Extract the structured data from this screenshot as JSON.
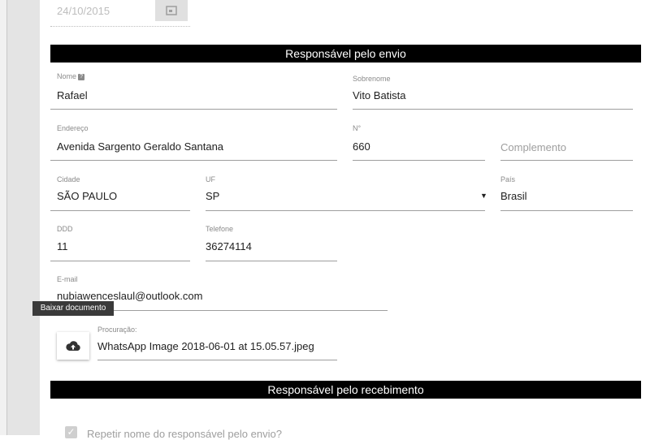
{
  "date_field": {
    "value": "24/10/2015"
  },
  "section_sender": {
    "title": "Responsável pelo envio"
  },
  "section_receiver": {
    "title": "Responsável pelo recebimento"
  },
  "fields": {
    "nome": {
      "label": "Nome",
      "value": "Rafael"
    },
    "sobrenome": {
      "label": "Sobrenome",
      "value": "Vito Batista"
    },
    "endereco": {
      "label": "Endereço",
      "value": "Avenida Sargento Geraldo Santana"
    },
    "numero": {
      "label": "N°",
      "value": "660"
    },
    "complemento": {
      "placeholder": "Complemento"
    },
    "cidade": {
      "label": "Cidade",
      "value": "SÃO PAULO"
    },
    "uf": {
      "label": "UF",
      "value": "SP"
    },
    "pais": {
      "label": "País",
      "value": "Brasil"
    },
    "ddd": {
      "label": "DDD",
      "value": "11"
    },
    "telefone": {
      "label": "Telefone",
      "value": "36274114"
    },
    "email": {
      "label": "E-mail",
      "value": "nubiawenceslaul@outlook.com"
    },
    "procuracao": {
      "label": "Procuração:",
      "value": "WhatsApp Image 2018-06-01 at 15.05.57.jpeg"
    }
  },
  "tooltip": {
    "text": "Baixar documento"
  },
  "repeat_checkbox": {
    "label": "Repetir nome do responsável pelo envio?",
    "checked": true
  },
  "icons": {
    "upload": "cloud-upload-icon",
    "calendar": "calendar-icon",
    "help": "help-icon",
    "dropdown": "caret-down-icon"
  },
  "colors": {
    "section_bar": "#000000",
    "tooltip": "#3a3a3a",
    "underline": "#9e9e9e"
  }
}
